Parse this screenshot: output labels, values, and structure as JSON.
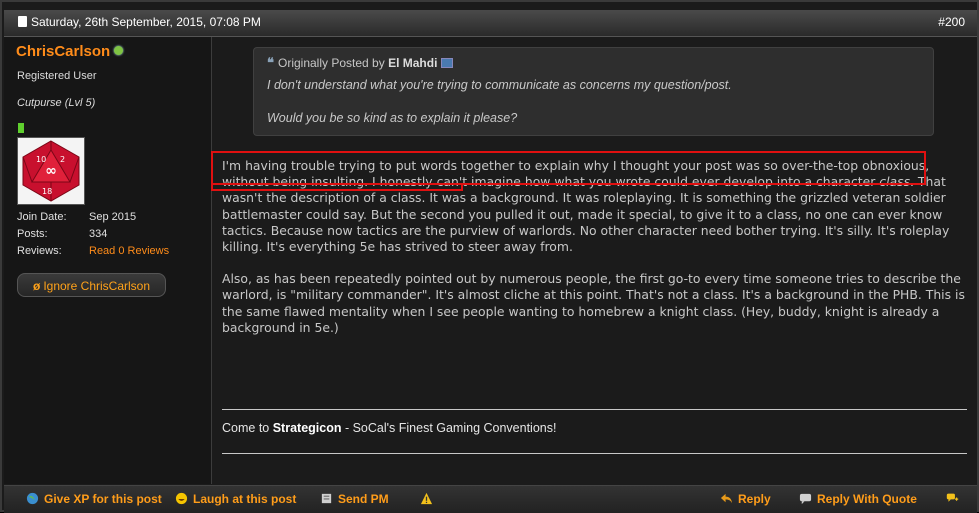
{
  "header": {
    "date": "Saturday, 26th September, 2015, 07:08 PM",
    "post_number": "#200"
  },
  "user": {
    "username": "ChrisCarlson",
    "title": "Registered User",
    "rank": "Cutpurse (Lvl 5)",
    "info": [
      {
        "label": "Join Date:",
        "value": "Sep 2015"
      },
      {
        "label": "Posts:",
        "value": "334"
      },
      {
        "label": "Reviews:",
        "value": "Read 0 Reviews"
      }
    ],
    "ignore_label": "Ignore ChrisCarlson"
  },
  "quote": {
    "prefix": "Originally Posted by",
    "author": "El Mahdi",
    "lines": [
      "I don't understand what you're trying to communicate as concerns my question/post.",
      "Would you be so kind as to explain it please?"
    ]
  },
  "body": {
    "p1_a": "I'm having trouble trying to put words together to explain why I thought your post was so over-the-top obnoxious, without being insulting. I honestly can't imagine how what you wrote could ever develop into a character ",
    "p1_em": "class",
    "p1_b": ". That wasn't the description of a class. It was a background. It was roleplaying. It is something the grizzled veteran soldier battlemaster could say. But the second you pulled it out, made it special, to give it to a class, no one can ever know tactics. Because now tactics are the purview of warlords. No other character need bother trying. It's silly. It's roleplay killing. It's everything 5e has strived to steer away from.",
    "p2": "Also, as has been repeatedly pointed out by numerous people, the first go-to every time someone tries to describe the warlord, is \"military commander\". It's almost cliche at this point. That's not a class. It's a background in the PHB. This is the same flawed mentality when I see people wanting to homebrew a knight class. (Hey, buddy, knight is already a background in 5e.)"
  },
  "signature": {
    "prefix": "Come to ",
    "bold": "Strategicon",
    "suffix": " - SoCal's Finest Gaming Conventions!"
  },
  "footer": {
    "give_xp": "Give XP for this post",
    "laugh": "Laugh at this post",
    "send_pm": "Send PM",
    "reply": "Reply",
    "reply_quote": "Reply With Quote"
  },
  "colors": {
    "accent": "#ff8c1a",
    "highlight": "#e01010",
    "online": "#7fc443"
  }
}
